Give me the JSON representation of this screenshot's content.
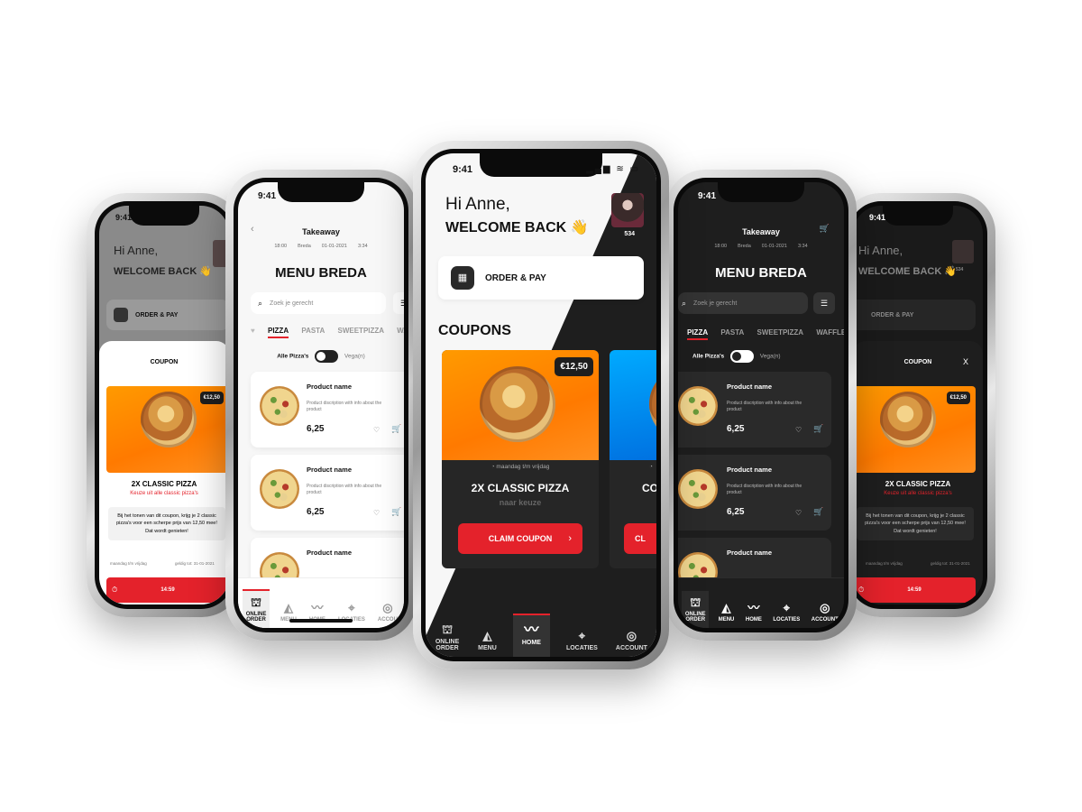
{
  "status": {
    "time": "9:41"
  },
  "brand": {
    "red": "#e4222b",
    "orange": "#ff8a00",
    "dark": "#1e1e1e",
    "light": "#f7f7f7"
  },
  "greeting": {
    "hi": "Hi Anne,",
    "welcome": "WELCOME BACK 👋",
    "welcome_small": "WELCOME BACK 👋",
    "points": "534"
  },
  "order_pay": {
    "label": "ORDER & PAY"
  },
  "coupons": {
    "section_title": "COUPONS",
    "price": "€12,50",
    "validity": "maandag t/m vrijdag",
    "title": "2X CLASSIC PIZZA",
    "subtitle": "naar keuze",
    "claim": "CLAIM COUPON",
    "peek_title": "CO",
    "peek_claim": "CL"
  },
  "coupon_detail": {
    "header": "COUPON",
    "close": "X",
    "price": "€12,50",
    "title": "2X CLASSIC PIZZA",
    "subtitle": "Keuze uit alle classic pizza's",
    "description": "Bij het tonen van dit coupon, krijg je 2 classic pizza's voor een scherpe prijs van 12,50 mee! Dat wordt genieten!",
    "validity": "maandag t/m vrijdag",
    "valid_until": "geldig tot: 31-01-2021",
    "timer": "14:59"
  },
  "menu": {
    "mode": "Takeaway",
    "time": "18:00",
    "city": "Breda",
    "date": "01-01-2021",
    "points": "3:34",
    "title": "MENU BREDA",
    "search_placeholder": "Zoek je gerecht",
    "tabs_light": [
      "PIZZA",
      "PASTA",
      "SWEETPIZZA",
      "WA"
    ],
    "tabs_dark": [
      "PIZZA",
      "PASTA",
      "SWEETPIZZA",
      "WAFFLES"
    ],
    "toggle_left": "Alle Pizza's",
    "toggle_right": "Vega(n)",
    "products": [
      {
        "name": "Product name",
        "desc": "Product discription with info about the product",
        "price": "6,25"
      },
      {
        "name": "Product name",
        "desc": "Product discription with info about the product",
        "price": "6,25"
      },
      {
        "name": "Product name",
        "desc": "",
        "price": ""
      }
    ]
  },
  "nav": {
    "online_order": "ONLINE ORDER",
    "menu": "MENU",
    "home": "HOME",
    "locaties": "LOCATIES",
    "account": "ACCOUNT",
    "accou": "ACCOU"
  }
}
